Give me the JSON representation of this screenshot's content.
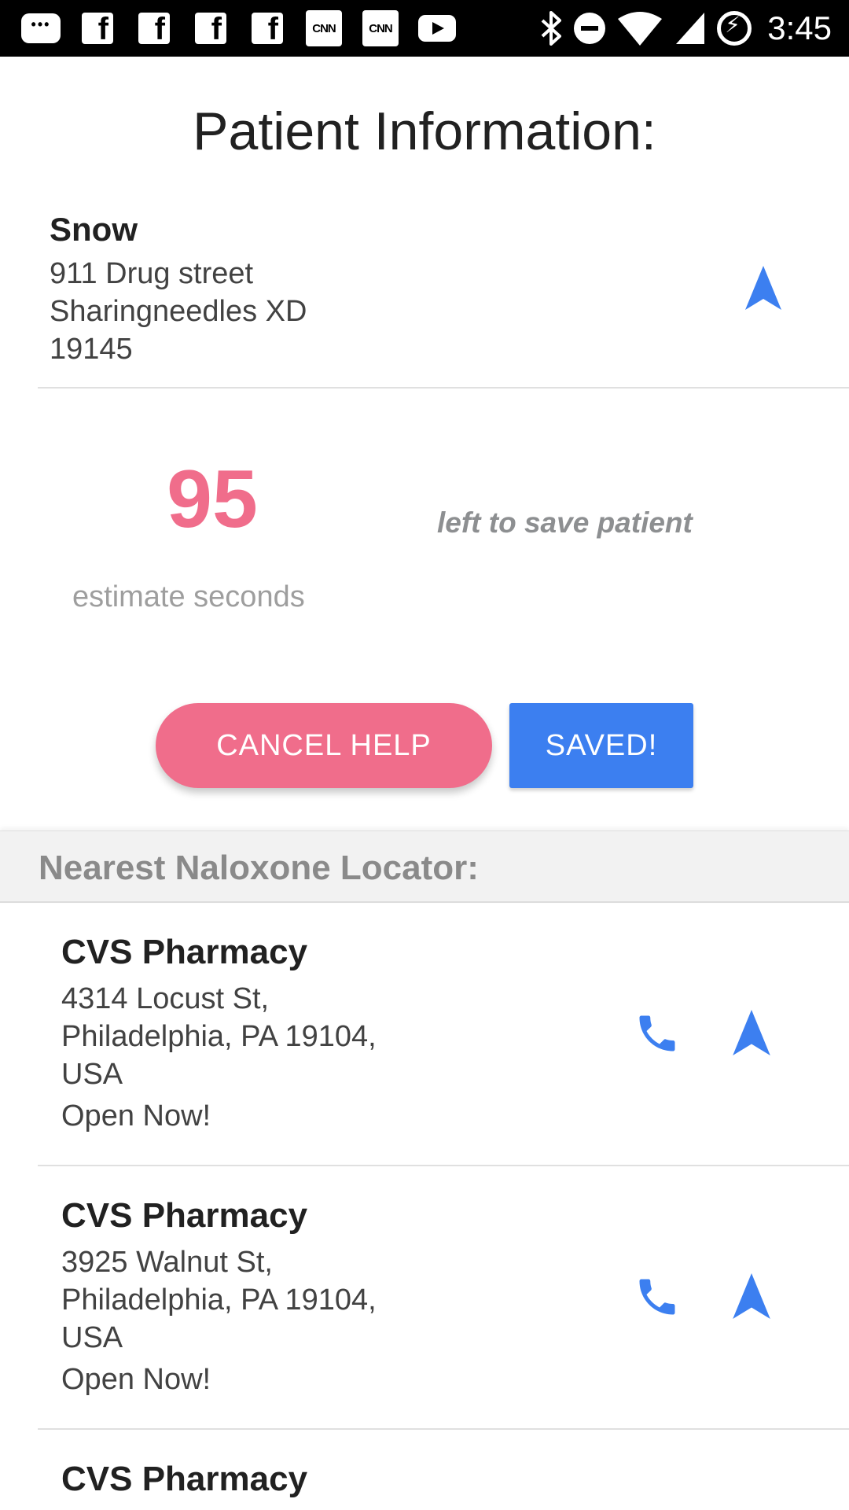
{
  "status_bar": {
    "time": "3:45",
    "notification_icons": [
      "chat-icon",
      "facebook-icon",
      "facebook-icon",
      "facebook-icon",
      "facebook-icon",
      "cnn-icon",
      "cnn-icon",
      "youtube-icon"
    ],
    "cnn_label": "CNN",
    "system_icons": [
      "bluetooth-icon",
      "do-not-disturb-icon",
      "wifi-icon",
      "cell-signal-icon",
      "battery-charging-icon"
    ]
  },
  "page_title": "Patient Information:",
  "patient": {
    "name": "Snow",
    "address_line1": "911 Drug street",
    "address_line2": "Sharingneedles XD",
    "address_line3": "19145"
  },
  "countdown": {
    "value": "95",
    "unit_label": "estimate seconds",
    "description": "left to save patient"
  },
  "buttons": {
    "cancel_label": "CANCEL HELP",
    "saved_label": "SAVED!"
  },
  "locator": {
    "title": "Nearest Naloxone Locator:",
    "pharmacies": [
      {
        "name": "CVS Pharmacy",
        "address_line1": "4314 Locust St,",
        "address_line2": "Philadelphia, PA 19104,",
        "address_line3": "USA",
        "status": "Open Now!"
      },
      {
        "name": "CVS Pharmacy",
        "address_line1": "3925 Walnut St,",
        "address_line2": "Philadelphia, PA 19104,",
        "address_line3": "USA",
        "status": "Open Now!"
      },
      {
        "name": "CVS Pharmacy"
      }
    ]
  },
  "colors": {
    "accent_pink": "#f06d8b",
    "accent_blue": "#3c7ff0",
    "status_bar_bg": "#000000"
  }
}
